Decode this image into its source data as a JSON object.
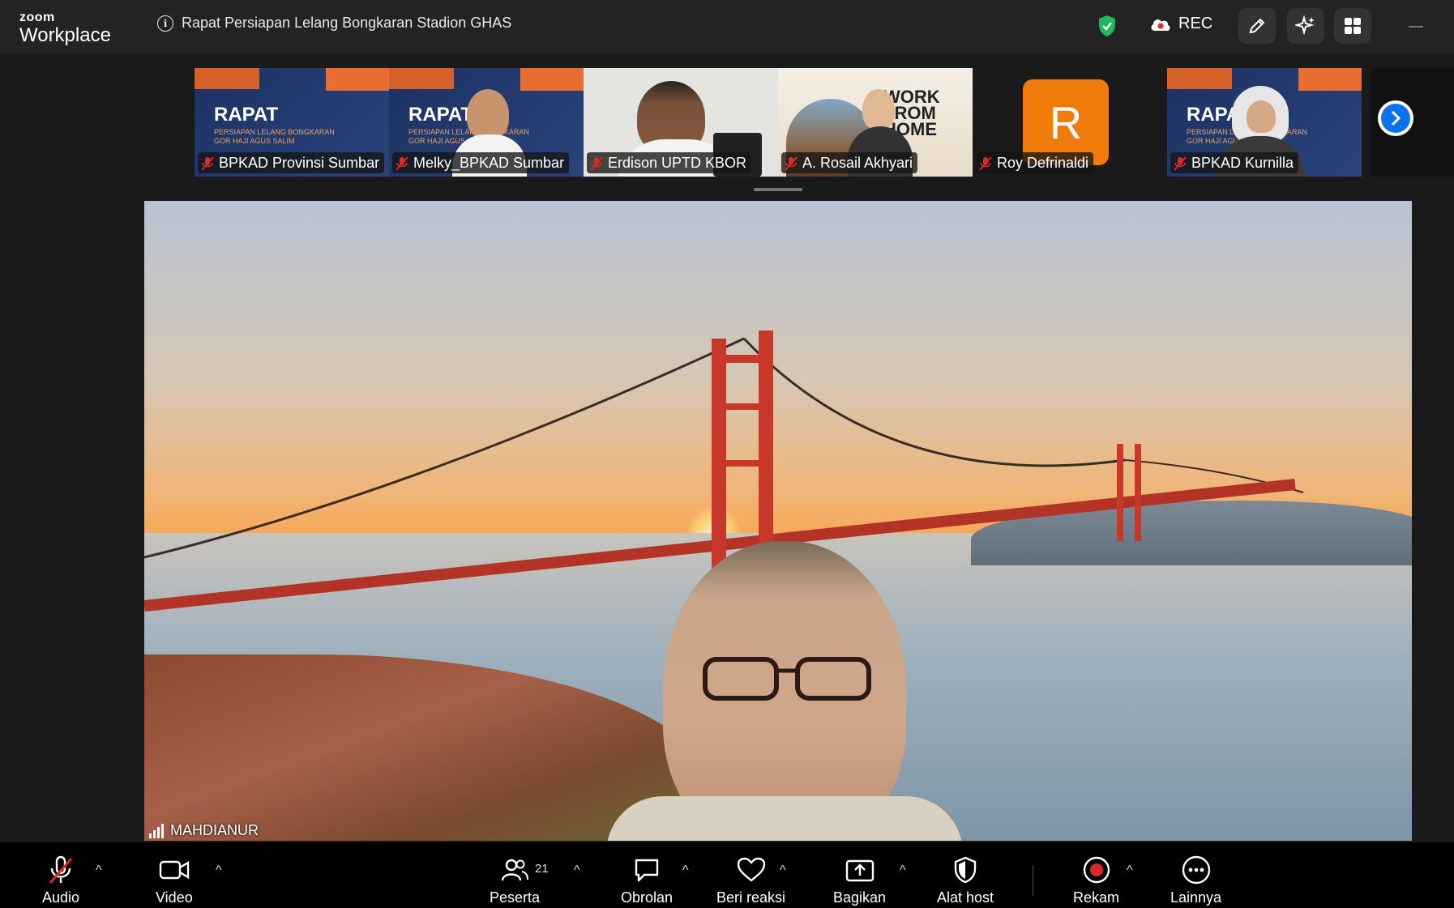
{
  "app": {
    "logo_top": "zoom",
    "logo_bottom": "Workplace"
  },
  "meeting": {
    "title": "Rapat Persiapan Lelang Bongkaran Stadion GHAS"
  },
  "header": {
    "rec_label": "REC"
  },
  "participants_strip": [
    {
      "name": "BPKAD Provinsi Sumbar",
      "muted": true
    },
    {
      "name": "Melky_BPKAD Sumbar",
      "muted": true
    },
    {
      "name": "Erdison UPTD KBOR",
      "muted": true
    },
    {
      "name": "A. Rosail Akhyari",
      "muted": true
    },
    {
      "name": "Roy Defrinaldi",
      "muted": true,
      "avatar_letter": "R",
      "avatar_color": "#f07a0a"
    },
    {
      "name": "BPKAD Kurnilla",
      "muted": true
    }
  ],
  "slide": {
    "heading": "RAPAT",
    "subtitle_line1": "PERSIAPAN LELANG BONGKARAN",
    "subtitle_line2": "GOR HAJI AGUS SALIM",
    "wfh_line1": "WORK",
    "wfh_line2": "FROM",
    "wfh_line3": "HOME"
  },
  "active_speaker": {
    "name": "MAHDIANUR"
  },
  "toolbar": {
    "audio": "Audio",
    "video": "Video",
    "participants": "Peserta",
    "participants_count": "21",
    "chat": "Obrolan",
    "reactions": "Beri reaksi",
    "share": "Bagikan",
    "host_tools": "Alat host",
    "record": "Rekam",
    "more": "Lainnya"
  },
  "colors": {
    "accent": "#0e72ed",
    "record": "#e02828",
    "muted": "#e02828",
    "secure": "#1fb85a"
  }
}
